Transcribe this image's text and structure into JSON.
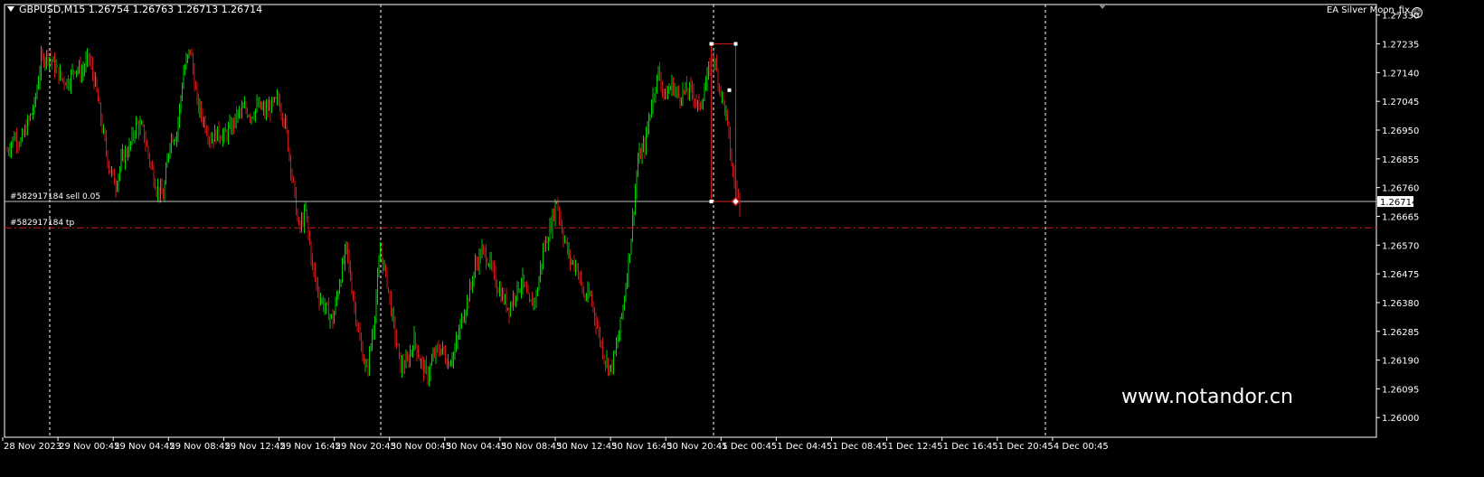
{
  "header": {
    "title": "GBPUSD,M15  1.26754 1.26763 1.26713 1.26714",
    "ea_label": "EA Silver Moon_fix"
  },
  "trade_lines": {
    "order_label": "#582917184 sell 0.05",
    "order_price": 1.26714,
    "order_color": "#c0c0c0",
    "tp_label": "#582917184 tp",
    "tp_price": 1.26627,
    "tp_color": "#d01818"
  },
  "current_price_label": "1.26714",
  "watermark": "www.notandor.cn",
  "colors": {
    "background": "#000000",
    "bull": "#00d000",
    "bear": "#d01818",
    "grid": "#ffffff",
    "axis_text": "#ffffff",
    "box": "#d01818"
  },
  "chart_data": {
    "type": "candlestick",
    "symbol": "GBPUSD",
    "timeframe": "M15",
    "ylim": [
      1.25935,
      1.27365
    ],
    "y_ticks": [
      "1.27330",
      "1.27235",
      "1.27140",
      "1.27045",
      "1.26950",
      "1.26855",
      "1.26760",
      "1.26665",
      "1.26570",
      "1.26475",
      "1.26380",
      "1.26285",
      "1.26190",
      "1.26095",
      "1.26000"
    ],
    "x_ticks": [
      "28 Nov 2023",
      "29 Nov 00:45",
      "29 Nov 04:45",
      "29 Nov 08:45",
      "29 Nov 12:45",
      "29 Nov 16:45",
      "29 Nov 20:45",
      "30 Nov 00:45",
      "30 Nov 04:45",
      "30 Nov 08:45",
      "30 Nov 12:45",
      "30 Nov 16:45",
      "30 Nov 20:45",
      "1 Dec 00:45",
      "1 Dec 04:45",
      "1 Dec 08:45",
      "1 Dec 12:45",
      "1 Dec 16:45",
      "1 Dec 20:45",
      "4 Dec 00:45"
    ],
    "day_separators": [
      "29 Nov",
      "30 Nov",
      "1 Dec",
      "4 Dec"
    ],
    "close_path": [
      [
        0,
        1.2688
      ],
      [
        5,
        1.2693
      ],
      [
        10,
        1.2691
      ],
      [
        15,
        1.2697
      ],
      [
        20,
        1.2703
      ],
      [
        25,
        1.2718
      ],
      [
        30,
        1.272
      ],
      [
        35,
        1.2716
      ],
      [
        40,
        1.2712
      ],
      [
        45,
        1.2711
      ],
      [
        50,
        1.2716
      ],
      [
        55,
        1.2714
      ],
      [
        60,
        1.2719
      ],
      [
        65,
        1.271
      ],
      [
        70,
        1.2696
      ],
      [
        75,
        1.2683
      ],
      [
        80,
        1.2677
      ],
      [
        85,
        1.2686
      ],
      [
        90,
        1.2689
      ],
      [
        95,
        1.2697
      ],
      [
        100,
        1.2695
      ],
      [
        105,
        1.2685
      ],
      [
        110,
        1.2676
      ],
      [
        115,
        1.2673
      ],
      [
        120,
        1.2692
      ],
      [
        125,
        1.2694
      ],
      [
        130,
        1.2714
      ],
      [
        135,
        1.2722
      ],
      [
        140,
        1.2704
      ],
      [
        145,
        1.2698
      ],
      [
        150,
        1.2692
      ],
      [
        155,
        1.2694
      ],
      [
        160,
        1.2693
      ],
      [
        165,
        1.2696
      ],
      [
        170,
        1.27
      ],
      [
        175,
        1.2702
      ],
      [
        180,
        1.27
      ],
      [
        185,
        1.2703
      ],
      [
        190,
        1.2701
      ],
      [
        195,
        1.2703
      ],
      [
        200,
        1.2705
      ],
      [
        205,
        1.2697
      ],
      [
        210,
        1.268
      ],
      [
        215,
        1.2662
      ],
      [
        220,
        1.2668
      ],
      [
        225,
        1.265
      ],
      [
        230,
        1.264
      ],
      [
        235,
        1.2636
      ],
      [
        240,
        1.2632
      ],
      [
        245,
        1.2645
      ],
      [
        250,
        1.2656
      ],
      [
        255,
        1.264
      ],
      [
        260,
        1.2625
      ],
      [
        265,
        1.2615
      ],
      [
        270,
        1.263
      ],
      [
        275,
        1.2655
      ],
      [
        280,
        1.2645
      ],
      [
        285,
        1.263
      ],
      [
        290,
        1.2617
      ],
      [
        295,
        1.2618
      ],
      [
        300,
        1.2626
      ],
      [
        305,
        1.2618
      ],
      [
        310,
        1.2614
      ],
      [
        315,
        1.2621
      ],
      [
        320,
        1.2623
      ],
      [
        325,
        1.2618
      ],
      [
        330,
        1.2622
      ],
      [
        335,
        1.2632
      ],
      [
        340,
        1.264
      ],
      [
        345,
        1.265
      ],
      [
        350,
        1.2655
      ],
      [
        355,
        1.2652
      ],
      [
        360,
        1.2645
      ],
      [
        365,
        1.264
      ],
      [
        370,
        1.2636
      ],
      [
        375,
        1.2642
      ],
      [
        380,
        1.2645
      ],
      [
        385,
        1.2637
      ],
      [
        390,
        1.264
      ],
      [
        395,
        1.2655
      ],
      [
        400,
        1.2662
      ],
      [
        405,
        1.2672
      ],
      [
        410,
        1.266
      ],
      [
        415,
        1.2652
      ],
      [
        420,
        1.265
      ],
      [
        425,
        1.264
      ],
      [
        430,
        1.264
      ],
      [
        435,
        1.263
      ],
      [
        440,
        1.262
      ],
      [
        445,
        1.2616
      ],
      [
        450,
        1.2625
      ],
      [
        455,
        1.264
      ],
      [
        460,
        1.266
      ],
      [
        465,
        1.2685
      ],
      [
        470,
        1.269
      ],
      [
        475,
        1.2704
      ],
      [
        480,
        1.2714
      ],
      [
        485,
        1.2706
      ],
      [
        490,
        1.271
      ],
      [
        495,
        1.2706
      ],
      [
        500,
        1.2708
      ],
      [
        505,
        1.2708
      ],
      [
        510,
        1.2702
      ],
      [
        515,
        1.271
      ],
      [
        520,
        1.272
      ],
      [
        525,
        1.271
      ],
      [
        530,
        1.27
      ],
      [
        535,
        1.268
      ],
      [
        540,
        1.2671
      ]
    ],
    "trade_box": {
      "from_bar": 519,
      "to_bar": 537,
      "high": 1.27235,
      "low": 1.26714
    }
  }
}
